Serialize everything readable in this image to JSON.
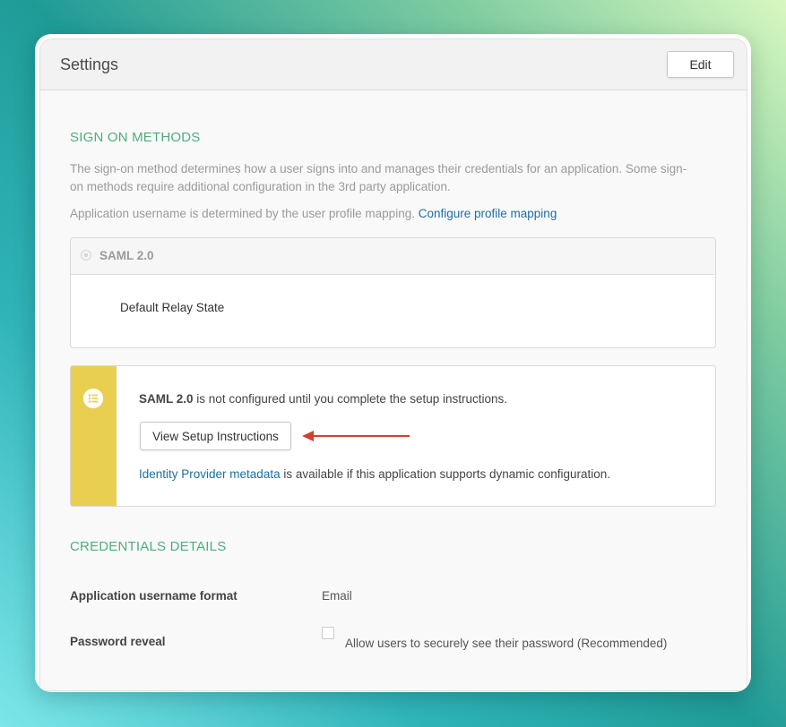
{
  "settings": {
    "title": "Settings",
    "edit_label": "Edit"
  },
  "sign_on": {
    "heading": "SIGN ON METHODS",
    "description_line1": "The sign-on method determines how a user signs into and manages their credentials for an application. Some sign-",
    "description_line2": "on methods require additional configuration in the 3rd party application.",
    "username_text": "Application username is determined by the user profile mapping.",
    "profile_link": "Configure profile mapping",
    "method": "SAML 2.0",
    "relay_state_label": "Default Relay State"
  },
  "notice": {
    "protocol": "SAML 2.0",
    "message": "is not configured until you complete the setup instructions.",
    "button_label": "View Setup Instructions",
    "metadata_link": "Identity Provider metadata",
    "metadata_text": "is available if this application supports dynamic configuration."
  },
  "credentials": {
    "heading": "CREDENTIALS DETAILS",
    "username_format_label": "Application username format",
    "username_format_value": "Email",
    "password_reveal_label": "Password reveal",
    "password_reveal_option": "Allow users to securely see their password (Recommended)"
  },
  "colors": {
    "accent_green": "#4cae80",
    "link_blue": "#1f6e9e",
    "notice_yellow": "#e9cf4f",
    "arrow_red": "#d0402f"
  },
  "icons": [
    "list-icon",
    "arrow-left-icon"
  ]
}
